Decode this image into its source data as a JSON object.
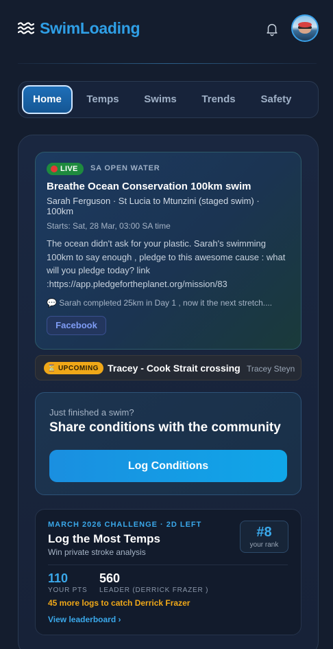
{
  "app": {
    "name": "SwimLoading"
  },
  "header": {
    "logo_icon": "waves-icon",
    "notification_icon": "bell-icon",
    "avatar_icon": "avatar-photo"
  },
  "tabs": [
    {
      "label": "Home",
      "active": true
    },
    {
      "label": "Temps",
      "active": false
    },
    {
      "label": "Swims",
      "active": false
    },
    {
      "label": "Trends",
      "active": false
    },
    {
      "label": "Safety",
      "active": false
    }
  ],
  "live_event": {
    "badge": "LIVE",
    "category": "SA OPEN WATER",
    "title": "Breathe Ocean Conservation 100km swim",
    "subtitle": "Sarah Ferguson · St Lucia to Mtunzini (staged swim) · 100km",
    "starts": "Starts: Sat, 28 Mar, 03:00 SA time",
    "description": "The ocean didn't ask for your plastic. Sarah's swimming 100km to say enough , pledge to this awesome cause : what will you pledge today? link :https://app.pledgefortheplanet.org/mission/83",
    "latest_update": "💬 Sarah completed 25km in Day 1 , now it the next stretch....",
    "social_button": "Facebook"
  },
  "upcoming_event": {
    "badge": "UPCOMING",
    "badge_icon": "hourglass-icon",
    "title": "Tracey - Cook Strait crossing",
    "swimmer": "Tracey Steyn"
  },
  "share_card": {
    "prompt": "Just finished a swim?",
    "title": "Share conditions with the community",
    "button": "Log Conditions"
  },
  "challenge": {
    "tag": "MARCH 2026 CHALLENGE · 2D LEFT",
    "title": "Log the Most Temps",
    "reward": "Win private stroke analysis",
    "rank": "#8",
    "rank_label": "your rank",
    "your_points": "110",
    "your_points_label": "YOUR PTS",
    "leader_points": "560",
    "leader_label": "LEADER (DERRICK FRAZER )",
    "gap_message": "45 more logs to catch Derrick Frazer",
    "link": "View leaderboard ›"
  },
  "colors": {
    "accent": "#2f9fe6",
    "live": "#1e8a3e",
    "upcoming": "#f0a818",
    "background": "#141d2e"
  }
}
